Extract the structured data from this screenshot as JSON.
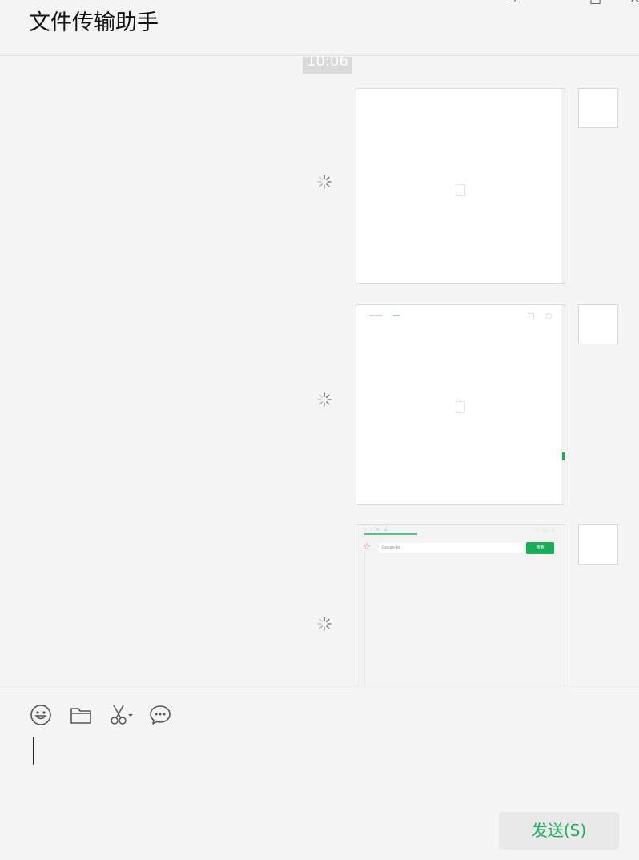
{
  "header": {
    "title": "文件传输助手",
    "controls": {
      "pin": "⊥",
      "maximize": "□",
      "close": "×"
    }
  },
  "messages": {
    "timestamp": "10:06",
    "items": [
      {
        "type": "image",
        "status": "sending",
        "thumb_caption": ""
      },
      {
        "type": "image",
        "status": "sending",
        "thumb_caption": ""
      },
      {
        "type": "image",
        "status": "sending",
        "thumb_search": "Gosge·ke",
        "thumb_button": "搜索"
      }
    ]
  },
  "composer": {
    "tools": [
      "emoji-icon",
      "folder-icon",
      "scissors-icon",
      "chat-history-icon"
    ],
    "input_value": "",
    "send_label": "发送(S)"
  },
  "colors": {
    "accent": "#1aad5a",
    "background": "#f4f4f4"
  }
}
